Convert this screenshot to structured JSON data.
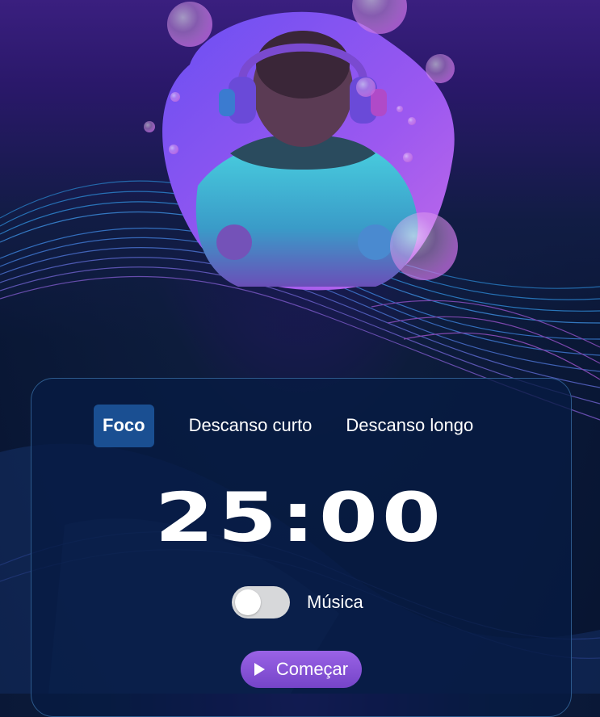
{
  "tabs": [
    {
      "label": "Foco",
      "active": true
    },
    {
      "label": "Descanso curto",
      "active": false
    },
    {
      "label": "Descanso longo",
      "active": false
    }
  ],
  "timer": {
    "display": "25:00"
  },
  "music": {
    "label": "Música",
    "enabled": false
  },
  "start_button": {
    "label": "Começar",
    "icon": "play-icon"
  },
  "hero": {
    "image": "person-with-headphones-illustration"
  },
  "colors": {
    "card_background": "#061b42",
    "active_tab": "#1a4f92",
    "start_button": "#8655d8",
    "toggle_off": "#d7d8da"
  }
}
